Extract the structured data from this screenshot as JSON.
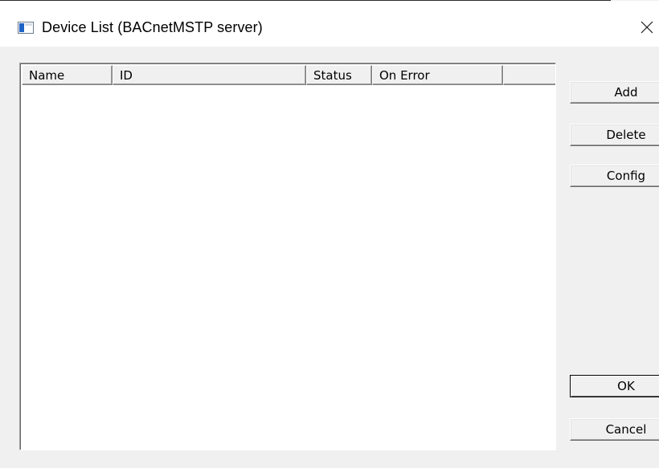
{
  "window": {
    "title": "Device List (BACnetMSTP server)",
    "icon": "window-app-icon",
    "close_icon": "close-icon"
  },
  "device_list": {
    "columns": [
      {
        "label": "Name"
      },
      {
        "label": "ID"
      },
      {
        "label": "Status"
      },
      {
        "label": "On Error"
      },
      {
        "label": ""
      }
    ],
    "rows": []
  },
  "buttons": {
    "add": "Add",
    "delete": "Delete",
    "config": "Config",
    "ok": "OK",
    "cancel": "Cancel"
  },
  "colors": {
    "dialog_background": "#f0f0f0",
    "title_background": "#ffffff",
    "icon_accent": "#1e63c6"
  }
}
